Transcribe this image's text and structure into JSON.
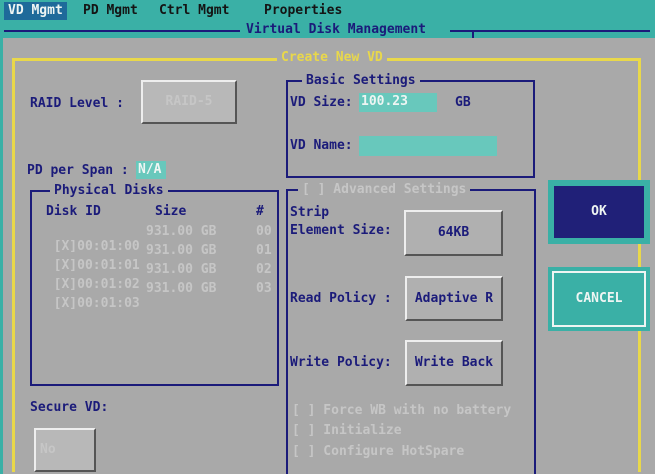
{
  "menu": {
    "items": [
      {
        "label": "VD Mgmt",
        "active": true
      },
      {
        "label": "PD Mgmt",
        "active": false
      },
      {
        "label": "Ctrl Mgmt",
        "active": false
      },
      {
        "label": "Properties",
        "active": false
      }
    ]
  },
  "window": {
    "title": "Virtual Disk Management",
    "dialog_title": "Create New VD"
  },
  "raid": {
    "label": "RAID Level :",
    "value": "RAID-5"
  },
  "pd_per_span": {
    "label": "PD per Span :",
    "value": "N/A"
  },
  "physical_disks": {
    "title": "Physical Disks",
    "headers": {
      "disk_id": "Disk ID",
      "size": "Size",
      "num": "#"
    },
    "rows": [
      {
        "checked": "[X]",
        "disk_id": "00:01:00",
        "size": "931.00 GB",
        "num": "00"
      },
      {
        "checked": "[X]",
        "disk_id": "00:01:01",
        "size": "931.00 GB",
        "num": "01"
      },
      {
        "checked": "[X]",
        "disk_id": "00:01:02",
        "size": "931.00 GB",
        "num": "02"
      },
      {
        "checked": "[X]",
        "disk_id": "00:01:03",
        "size": "931.00 GB",
        "num": "03"
      }
    ]
  },
  "secure_vd": {
    "label": "Secure VD:",
    "value": "No"
  },
  "basic": {
    "title": "Basic Settings",
    "vd_size_label": "VD Size:",
    "vd_size_value": "100.23",
    "vd_size_unit": "GB",
    "vd_name_label": "VD Name:",
    "vd_name_value": ""
  },
  "advanced": {
    "title": "[ ] Advanced Settings",
    "strip_label_line1": "Strip",
    "strip_label_line2": "Element Size:",
    "strip_value": "64KB",
    "read_policy_label": "Read Policy :",
    "read_policy_value": "Adaptive R",
    "write_policy_label": "Write Policy:",
    "write_policy_value": "Write Back",
    "options": [
      "[ ] Force WB with no battery",
      "[ ] Initialize",
      "[ ] Configure HotSpare"
    ]
  },
  "buttons": {
    "ok": "OK",
    "cancel": "CANCEL"
  },
  "colors": {
    "teal": "#3ab0a6",
    "navy": "#1b1b7a",
    "gray_bg": "#a9a9a9",
    "yellow_frame": "#e9d84a"
  }
}
